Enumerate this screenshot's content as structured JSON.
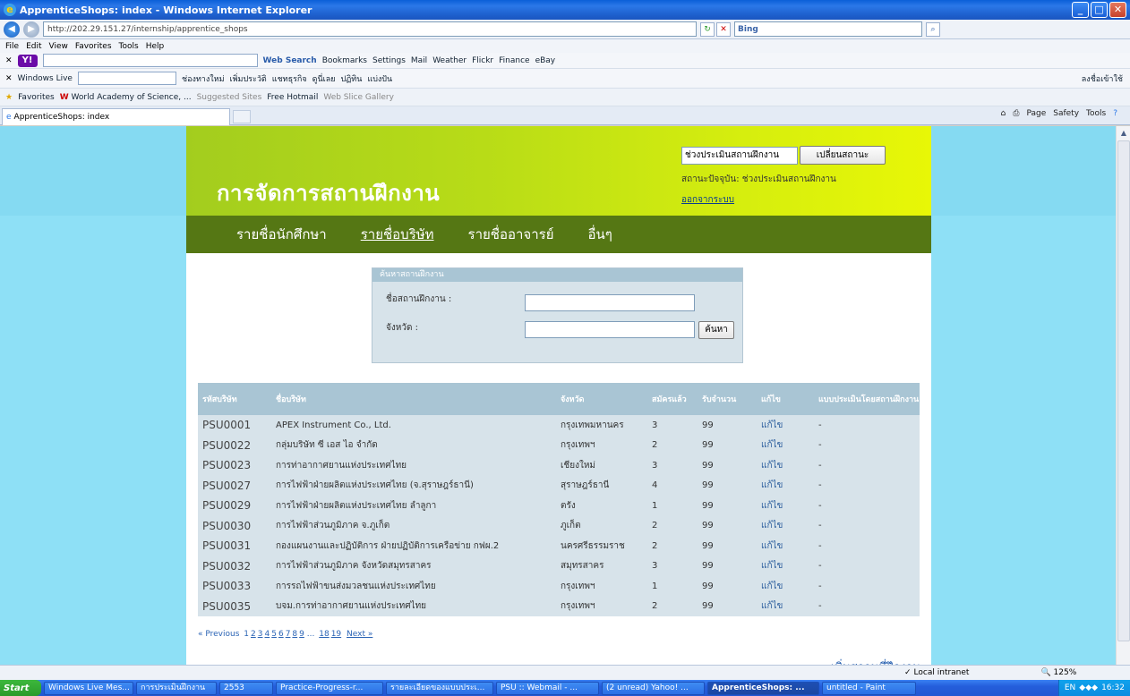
{
  "window": {
    "title": "ApprenticeShops: index - Windows Internet Explorer"
  },
  "browser": {
    "address": "http://202.29.151.27/internship/apprentice_shops",
    "search_placeholder": "Bing",
    "menu": [
      "File",
      "Edit",
      "View",
      "Favorites",
      "Tools",
      "Help"
    ],
    "toolbar1": [
      "Web Search",
      "Bookmarks",
      "Settings",
      "Mail",
      "Weather",
      "Flickr",
      "Finance",
      "eBay"
    ],
    "toolbar2_label": "Windows Live",
    "toolbar2_links": [
      "ช่องทางใหม่",
      "เพิ่มประวัติ",
      "แชทธุรกิจ",
      "ดูนี่เลย",
      "ปฏิทิน",
      "แบ่งปัน"
    ],
    "toolbar2_right": "ลงชื่อเข้าใช้",
    "favorites_label": "Favorites",
    "favorites": [
      "World Academy of Science, ...",
      "Suggested Sites",
      "Free Hotmail",
      "Web Slice Gallery"
    ],
    "tab_title": "ApprenticeShops: index",
    "command_bar": [
      "Page",
      "Safety",
      "Tools"
    ],
    "status_zone": "Local intranet",
    "zoom": "125%"
  },
  "site": {
    "title": "การจัดการสถานฝึกงาน",
    "status_select": "ช่วงประเมินสถานฝึกงาน",
    "status_button": "เปลี่ยนสถานะ",
    "status_current": "สถานะปัจจุบัน: ช่วงประเมินสถานฝึกงาน",
    "logout": "ออกจากระบบ",
    "nav": [
      "รายชื่อนักศึกษา",
      "รายชื่อบริษัท",
      "รายชื่ออาจารย์",
      "อื่นๆ"
    ],
    "search": {
      "heading": "ค้นหาสถานฝึกงาน",
      "name_label": "ชื่อสถานฝึกงาน :",
      "province_label": "จังหวัด :",
      "button": "ค้นหา"
    },
    "table": {
      "headers": [
        "รหัสบริษัท",
        "ชื่อบริษัท",
        "จังหวัด",
        "สมัครแล้ว",
        "รับจำนวน",
        "แก้ไข",
        "แบบประเมินโดยสถานฝึกงาน"
      ],
      "rows": [
        [
          "PSU0001",
          "APEX Instrument Co., Ltd.",
          "กรุงเทพมหานคร",
          "3",
          "99",
          "แก้ไข",
          "-"
        ],
        [
          "PSU0022",
          "กลุ่มบริษัท ซี เอส ไอ จำกัด",
          "กรุงเทพฯ",
          "2",
          "99",
          "แก้ไข",
          "-"
        ],
        [
          "PSU0023",
          "การท่าอากาศยานแห่งประเทศไทย",
          "เชียงใหม่",
          "3",
          "99",
          "แก้ไข",
          "-"
        ],
        [
          "PSU0027",
          "การไฟฟ้าฝ่ายผลิตแห่งประเทศไทย (จ.สุราษฎร์ธานี)",
          "สุราษฎร์ธานี",
          "4",
          "99",
          "แก้ไข",
          "-"
        ],
        [
          "PSU0029",
          "การไฟฟ้าฝ่ายผลิตแห่งประเทศไทย ลำลูกา",
          "ตรัง",
          "1",
          "99",
          "แก้ไข",
          "-"
        ],
        [
          "PSU0030",
          "การไฟฟ้าส่วนภูมิภาค จ.ภูเก็ต",
          "ภูเก็ต",
          "2",
          "99",
          "แก้ไข",
          "-"
        ],
        [
          "PSU0031",
          "กองแผนงานและปฏิบัติการ ฝ่ายปฏิบัติการเครือข่าย กฟผ.2",
          "นครศรีธรรมราช",
          "2",
          "99",
          "แก้ไข",
          "-"
        ],
        [
          "PSU0032",
          "การไฟฟ้าส่วนภูมิภาค จังหวัดสมุทรสาคร",
          "สมุทรสาคร",
          "3",
          "99",
          "แก้ไข",
          "-"
        ],
        [
          "PSU0033",
          "การรถไฟฟ้าขนส่งมวลชนแห่งประเทศไทย",
          "กรุงเทพฯ",
          "1",
          "99",
          "แก้ไข",
          "-"
        ],
        [
          "PSU0035",
          "บจม.การท่าอากาศยานแห่งประเทศไทย",
          "กรุงเทพฯ",
          "2",
          "99",
          "แก้ไข",
          "-"
        ]
      ]
    },
    "pager": {
      "prev": "« Previous",
      "pages": [
        "1",
        "2",
        "3",
        "4",
        "5",
        "6",
        "7",
        "8",
        "9"
      ],
      "ellipsis": "...",
      "tail": [
        "18",
        "19"
      ],
      "next": "Next »"
    },
    "add_link": "เพิ่มสถานที่ฝึกงาน"
  },
  "taskbar": {
    "start": "Start",
    "tasks": [
      "Windows Live Mes...",
      "การประเมินฝึกงาน",
      "2553",
      "Practice-Progress-r...",
      "รายละเอียดของแบบประเ...",
      "PSU :: Webmail - ...",
      "(2 unread) Yahoo! ...",
      "ApprenticeShops: ...",
      "untitled - Paint"
    ],
    "clock": "16:32",
    "lang": "EN"
  }
}
